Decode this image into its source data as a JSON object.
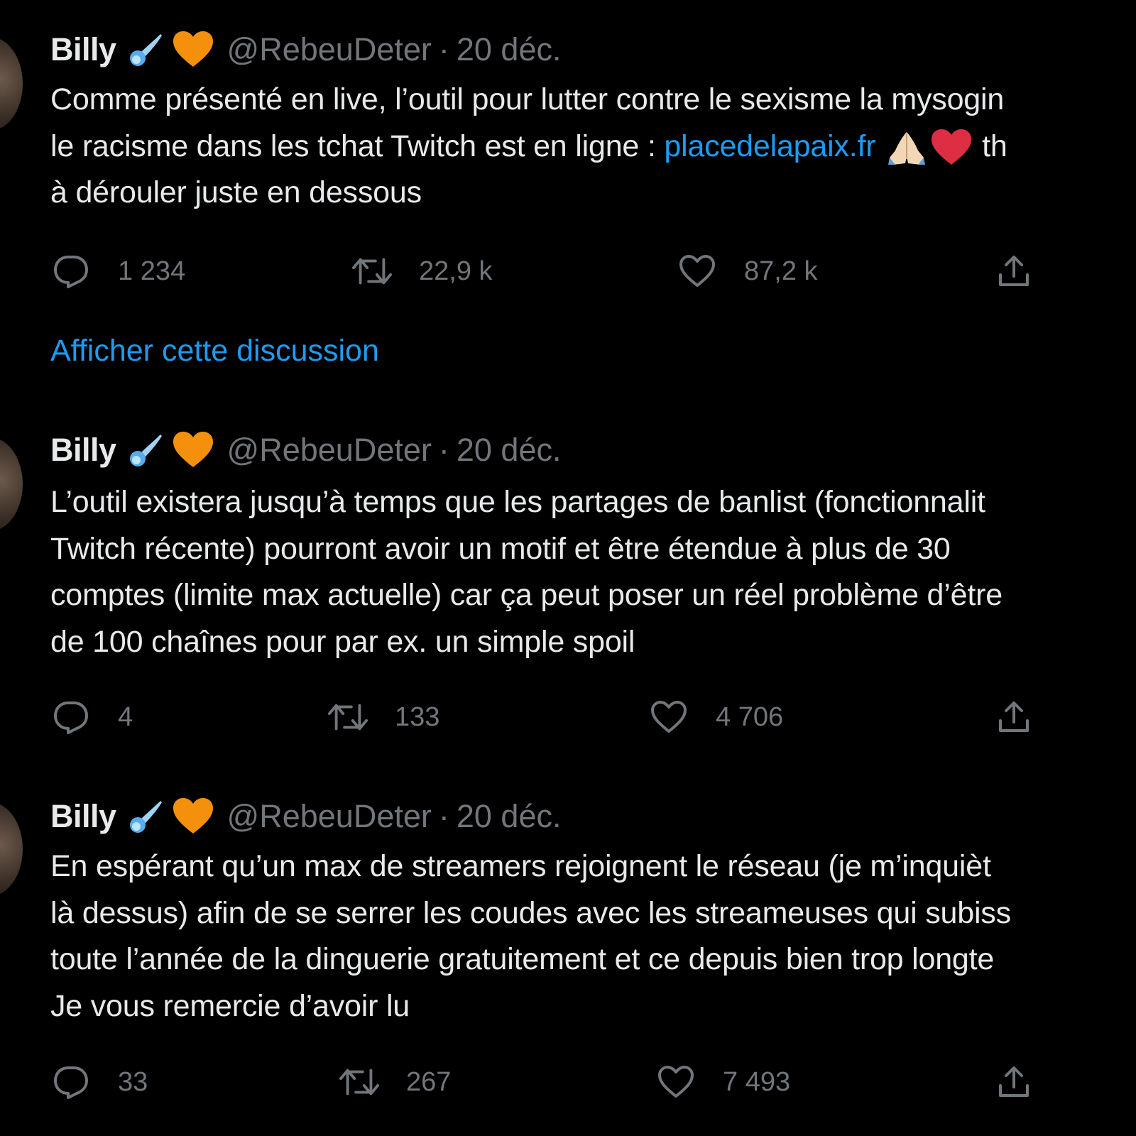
{
  "colors": {
    "background": "#000000",
    "text": "#e7e9ea",
    "secondary": "#71767b",
    "link": "#1d9bf0",
    "heart_emoji": "#f4900c",
    "red_heart": "#e0245e"
  },
  "tweets": [
    {
      "author": "Billy",
      "handle": "@RebeuDeter",
      "separator": "·",
      "date": "20 déc.",
      "lines": [
        {
          "text": "Comme présenté en live, l’outil pour lutter contre le sexisme la mysogin"
        },
        {
          "text_before": "le racisme dans les tchat Twitch est en ligne : ",
          "link": "placedelapaix.fr",
          "text_after": " th"
        },
        {
          "text": "à dérouler juste en dessous"
        }
      ],
      "replies": "1 234",
      "retweets": "22,9 k",
      "likes": "87,2 k"
    },
    {
      "author": "Billy",
      "handle": "@RebeuDeter",
      "separator": "·",
      "date": "20 déc.",
      "lines": [
        {
          "text": "L’outil existera jusqu’à temps que les partages de banlist (fonctionnalit"
        },
        {
          "text": "Twitch récente) pourront avoir un motif et être étendue à plus de 30"
        },
        {
          "text": "comptes (limite max actuelle) car ça peut poser un réel problème d’être"
        },
        {
          "text": "de 100 chaînes pour par ex. un simple spoil"
        }
      ],
      "replies": "4",
      "retweets": "133",
      "likes": "4 706"
    },
    {
      "author": "Billy",
      "handle": "@RebeuDeter",
      "separator": "·",
      "date": "20 déc.",
      "lines": [
        {
          "text": "En espérant qu’un max de streamers rejoignent le réseau (je m’inquièt"
        },
        {
          "text": "là dessus) afin de se serrer les coudes avec les streameuses qui subiss"
        },
        {
          "text": "toute l’année de la dinguerie gratuitement et ce depuis bien trop longte"
        },
        {
          "text": "Je vous remercie d’avoir lu"
        }
      ],
      "replies": "33",
      "retweets": "267",
      "likes": "7 493"
    }
  ],
  "show_thread": "Afficher cette discussion",
  "icons": {
    "name_emojis": [
      "comet-emoji",
      "orange-heart-emoji"
    ],
    "link_emojis": [
      "folded-hands-emoji",
      "red-heart-emoji"
    ],
    "actions": [
      "reply-icon",
      "retweet-icon",
      "like-icon",
      "share-icon"
    ]
  }
}
